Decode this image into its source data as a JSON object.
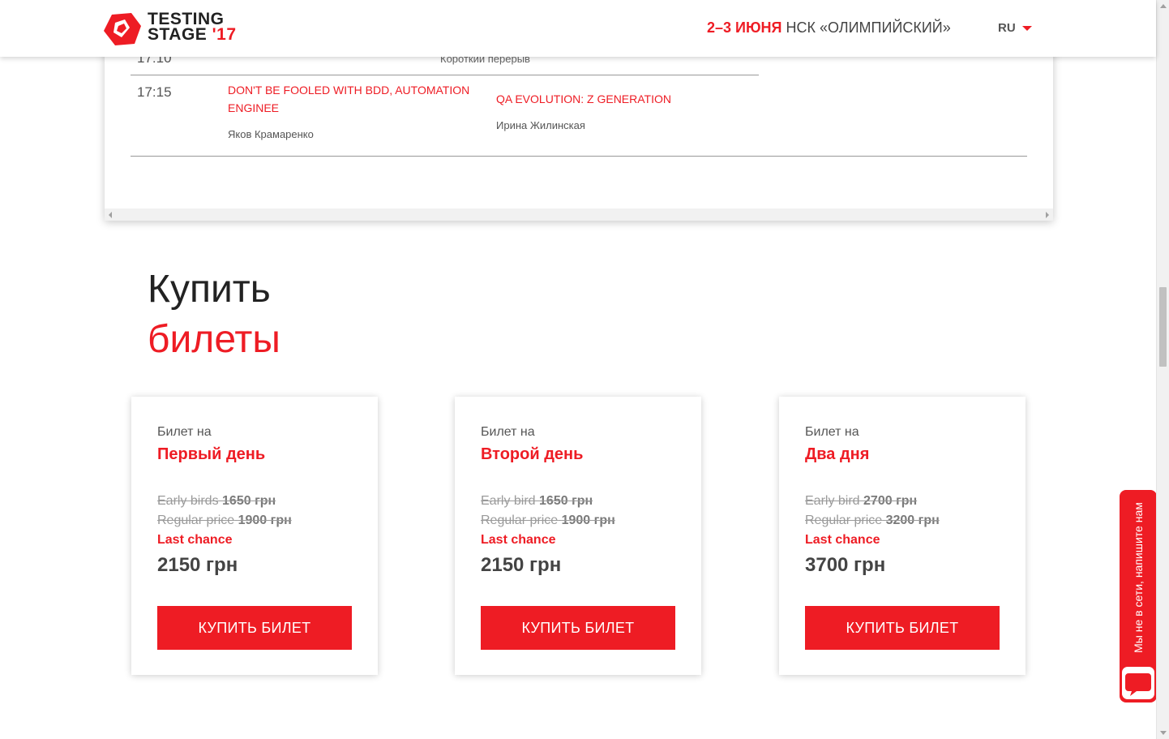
{
  "header": {
    "logo_line1": "TESTING",
    "logo_line2": "STAGE",
    "logo_year": "'17",
    "event_dates": "2–3 ИЮНЯ",
    "event_venue": "НСК «ОЛИМПИЙСКИЙ»",
    "language": "RU"
  },
  "schedule": {
    "prev_row": {
      "time": "17:10",
      "label": "Короткий перерыв"
    },
    "rows": [
      {
        "time": "17:15",
        "talks": [
          {
            "title": "DON'T BE FOOLED WITH BDD, AUTOMATION ENGINEE",
            "speaker": "Яков Крамаренко"
          },
          {
            "title": "QA EVOLUTION: Z GENERATION",
            "speaker": "Ирина Жилинская"
          }
        ]
      }
    ]
  },
  "tickets": {
    "title_line1": "Купить",
    "title_line2": "билеты",
    "cards": [
      {
        "label": "Билет на",
        "day": "Первый день",
        "early_label": "Early birds",
        "early_price": "1650 грн",
        "regular_label": "Regular price",
        "regular_price": "1900 грн",
        "last_label": "Last chance",
        "price": "2150 грн",
        "button": "КУПИТЬ БИЛЕТ"
      },
      {
        "label": "Билет на",
        "day": "Второй день",
        "early_label": "Early bird",
        "early_price": "1650 грн",
        "regular_label": "Regular price",
        "regular_price": "1900 грн",
        "last_label": "Last chance",
        "price": "2150 грн",
        "button": "КУПИТЬ БИЛЕТ"
      },
      {
        "label": "Билет на",
        "day": "Два дня",
        "early_label": "Early bird",
        "early_price": "2700 грн",
        "regular_label": "Regular price",
        "regular_price": "3200 грн",
        "last_label": "Last chance",
        "price": "3700 грн",
        "button": "КУПИТЬ БИЛЕТ"
      }
    ]
  },
  "chat_widget": {
    "text": "Мы не в сети, напишите нам",
    "icon": "chat-bubble-icon"
  },
  "colors": {
    "accent": "#ee1c24",
    "text_dark": "#222222",
    "text_muted": "#9a9a9a"
  }
}
